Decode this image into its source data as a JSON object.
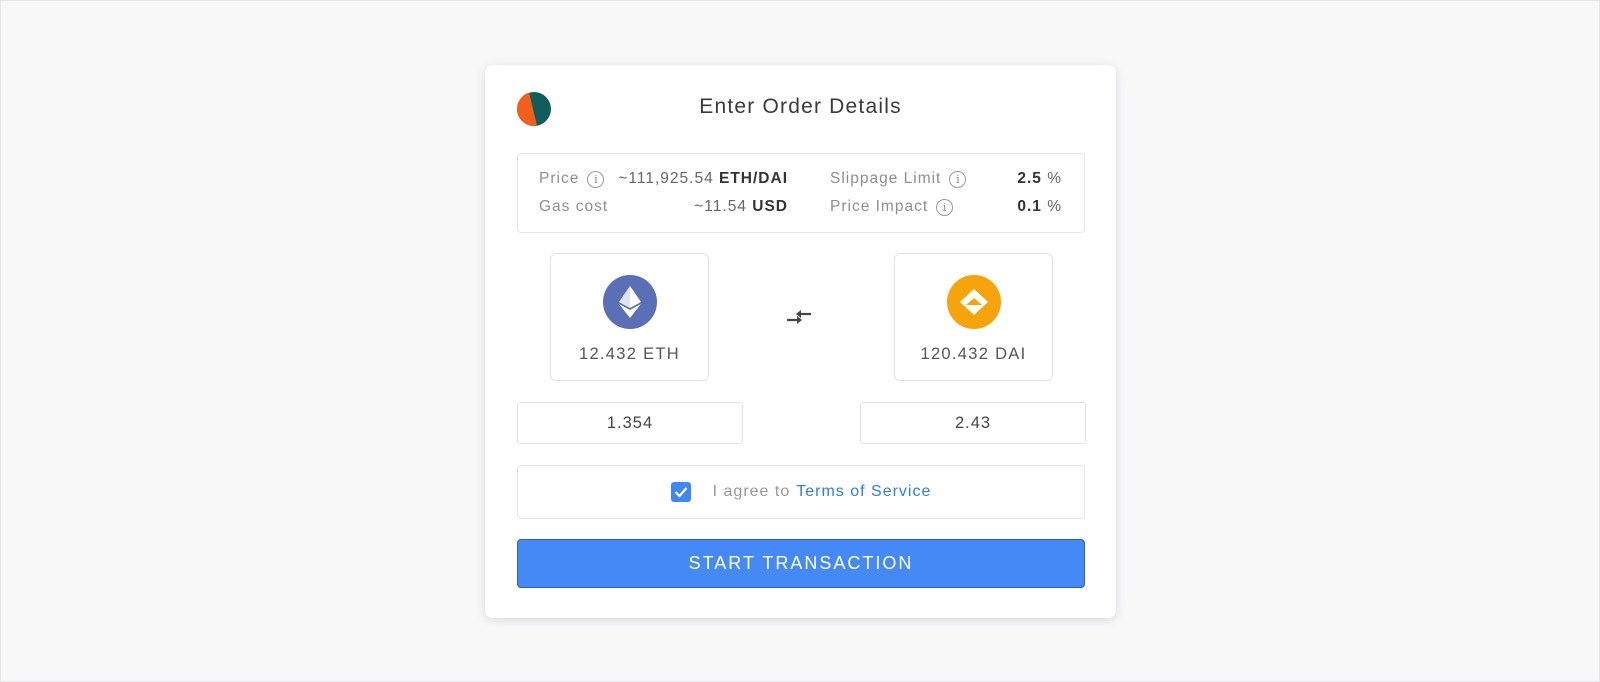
{
  "header": {
    "title": "Enter Order Details"
  },
  "info": {
    "price_label": "Price",
    "price_value": "~111,925.54",
    "price_unit": "ETH/DAI",
    "gas_label": "Gas cost",
    "gas_value": "~11.54",
    "gas_unit": "USD",
    "slippage_label": "Slippage Limit",
    "slippage_value": "2.5",
    "slippage_unit": "%",
    "impact_label": "Price Impact",
    "impact_value": "0.1",
    "impact_unit": "%"
  },
  "tokens": {
    "from": {
      "amount": "12.432 ETH",
      "icon": "ethereum-icon",
      "color": "#5a6fb5"
    },
    "to": {
      "amount": "120.432 DAI",
      "icon": "dai-icon",
      "color": "#f6a30c"
    }
  },
  "inputs": {
    "from_value": "1.354",
    "to_value": "2.43"
  },
  "terms": {
    "prefix": "I agree to",
    "link": "Terms of Service",
    "checked": true
  },
  "actions": {
    "start_label": "START TRANSACTION"
  },
  "colors": {
    "accent": "#4589f7",
    "link": "#2f7de1"
  }
}
